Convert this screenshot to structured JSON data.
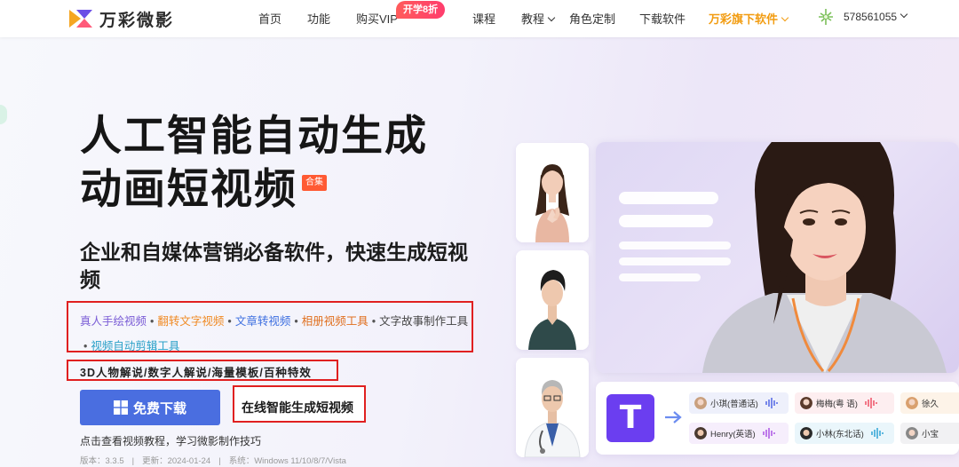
{
  "nav": {
    "brand": "万彩微影",
    "items": [
      {
        "label": "首页"
      },
      {
        "label": "功能"
      },
      {
        "label": "购买VIP"
      },
      {
        "label": "课程"
      },
      {
        "label": "教程"
      },
      {
        "label": "角色定制"
      },
      {
        "label": "下载软件"
      },
      {
        "label": "万彩旗下软件"
      }
    ],
    "vip_badge": "开学8折",
    "user_id": "578561055",
    "accent_color": "#f29c11"
  },
  "hero": {
    "title_line1": "人工智能自动生成",
    "title_line2": "动画短视频",
    "tag": "合集",
    "subtitle": "企业和自媒体营销必备软件，快速生成短视频",
    "links": [
      {
        "label": "真人手绘视频",
        "color": "#7a5cd6"
      },
      {
        "label": "翻转文字视频",
        "color": "#f08a24"
      },
      {
        "label": "文章转视频",
        "color": "#3d6fe0"
      },
      {
        "label": "相册视频工具",
        "color": "#e07020"
      },
      {
        "label": "文字故事制作工具",
        "color": "#444444"
      },
      {
        "label": "视频自动剪辑工具",
        "color": "#2aa0c8"
      }
    ],
    "features": "3D人物解说/数字人解说/海量模板/百种特效",
    "download_label": "免费下载",
    "online_label": "在线智能生成短视频",
    "tutorial": "点击查看视频教程，学习微影制作技巧",
    "version_label": "版本：3.3.5",
    "update_label": "更新：2024-01-24",
    "system_label": "系统：Windows 11/10/8/7/Vista",
    "button_color": "#4a6ee0"
  },
  "voices": [
    {
      "label": "小琪(普通话)",
      "bg": "#eef0fb",
      "wave": "#5b6ee6"
    },
    {
      "label": "梅梅(粤 语)",
      "bg": "#fdeef0",
      "wave": "#f05a6e"
    },
    {
      "label": "徐久",
      "bg": "#fdf3e8",
      "wave": "#f0a040"
    },
    {
      "label": "Henry(英语)",
      "bg": "#f6eefc",
      "wave": "#b05ee6"
    },
    {
      "label": "小林(东北话)",
      "bg": "#eaf6fb",
      "wave": "#3aa8d8"
    },
    {
      "label": "小宝",
      "bg": "#f1f1f3",
      "wave": "#888888"
    }
  ]
}
